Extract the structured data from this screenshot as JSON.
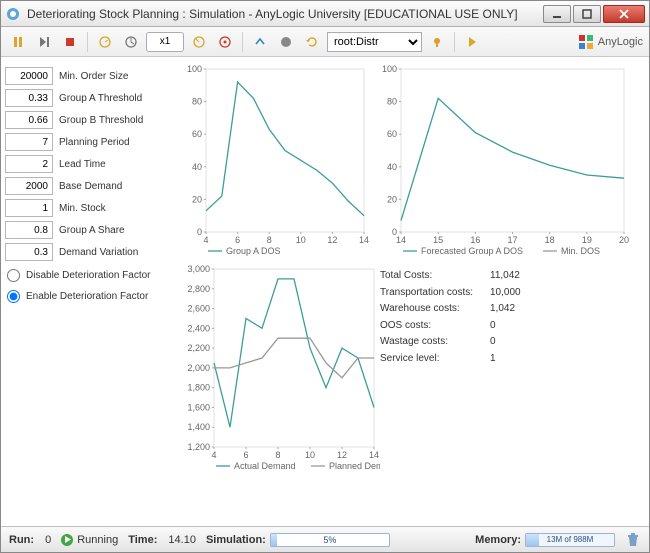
{
  "window": {
    "title": "Deteriorating Stock Planning : Simulation - AnyLogic University  [EDUCATIONAL USE ONLY]"
  },
  "toolbar": {
    "speed": "x1",
    "nav_value": "root:Distr",
    "brand": "AnyLogic"
  },
  "params": {
    "min_order_size": {
      "value": "20000",
      "label": "Min. Order Size"
    },
    "group_a_threshold": {
      "value": "0.33",
      "label": "Group A Threshold"
    },
    "group_b_threshold": {
      "value": "0.66",
      "label": "Group B Threshold"
    },
    "planning_period": {
      "value": "7",
      "label": "Planning Period"
    },
    "lead_time": {
      "value": "2",
      "label": "Lead Time"
    },
    "base_demand": {
      "value": "2000",
      "label": "Base Demand"
    },
    "min_stock": {
      "value": "1",
      "label": "Min. Stock"
    },
    "group_a_share": {
      "value": "0.8",
      "label": "Group A Share"
    },
    "demand_variation": {
      "value": "0.3",
      "label": "Demand Variation"
    }
  },
  "radios": {
    "disable": "Disable Deterioration Factor",
    "enable": "Enable Deterioration Factor",
    "selected": "enable"
  },
  "costs": {
    "total_label": "Total Costs:",
    "total_value": "11,042",
    "transport_label": "Transportation costs:",
    "transport_value": "10,000",
    "warehouse_label": "Warehouse costs:",
    "warehouse_value": "1,042",
    "oos_label": "OOS costs:",
    "oos_value": "0",
    "wastage_label": "Wastage costs:",
    "wastage_value": "0",
    "service_label": "Service level:",
    "service_value": "1"
  },
  "status": {
    "run_label": "Run:",
    "run_value": "0",
    "state": "Running",
    "time_label": "Time:",
    "time_value": "14.10",
    "sim_label": "Simulation:",
    "sim_progress_pct": 5,
    "sim_progress_text": "5%",
    "mem_label": "Memory:",
    "mem_text": "13M of 988M"
  },
  "chart_data": [
    {
      "id": "group_a_dos",
      "type": "line",
      "title": "",
      "xlabel": "",
      "ylabel": "",
      "xlim": [
        4,
        14
      ],
      "ylim": [
        0,
        100
      ],
      "x_ticks": [
        4,
        6,
        8,
        10,
        12,
        14
      ],
      "y_ticks": [
        0,
        20,
        40,
        60,
        80,
        100
      ],
      "series": [
        {
          "name": "Group A DOS",
          "color": "#3b9e95",
          "x": [
            4,
            5,
            6,
            7,
            8,
            9,
            10,
            11,
            12,
            13,
            14
          ],
          "y": [
            13,
            22,
            92,
            82,
            63,
            50,
            44,
            38,
            30,
            19,
            10
          ]
        }
      ],
      "legend": [
        "Group A DOS"
      ]
    },
    {
      "id": "forecasted_dos",
      "type": "line",
      "xlim": [
        14,
        20
      ],
      "ylim": [
        0,
        100
      ],
      "x_ticks": [
        14,
        15,
        16,
        17,
        18,
        19,
        20
      ],
      "y_ticks": [
        0,
        20,
        40,
        60,
        80,
        100
      ],
      "series": [
        {
          "name": "Forecasted Group A DOS",
          "color": "#3b9e95",
          "x": [
            14,
            15,
            16,
            17,
            18,
            19,
            20
          ],
          "y": [
            7,
            82,
            61,
            49,
            41,
            35,
            33
          ]
        },
        {
          "name": "Min. DOS",
          "color": "#999999",
          "x": [
            14,
            20
          ],
          "y": [
            null,
            null
          ]
        }
      ],
      "legend": [
        "Forecasted Group A DOS",
        "Min. DOS"
      ]
    },
    {
      "id": "demand",
      "type": "line",
      "xlim": [
        4,
        14
      ],
      "ylim": [
        1200,
        3000
      ],
      "x_ticks": [
        4,
        6,
        8,
        10,
        12,
        14
      ],
      "y_ticks": [
        1200,
        1400,
        1600,
        1800,
        2000,
        2200,
        2400,
        2600,
        2800,
        3000
      ],
      "series": [
        {
          "name": "Actual Demand",
          "color": "#3b9e95",
          "x": [
            4,
            5,
            6,
            7,
            8,
            9,
            10,
            11,
            12,
            13,
            14
          ],
          "y": [
            2050,
            1400,
            2500,
            2400,
            2900,
            2900,
            2200,
            1800,
            2200,
            2100,
            1600
          ]
        },
        {
          "name": "Planned Demand",
          "color": "#999999",
          "x": [
            4,
            5,
            6,
            7,
            8,
            9,
            10,
            11,
            12,
            13,
            14
          ],
          "y": [
            2000,
            2000,
            2050,
            2100,
            2300,
            2300,
            2300,
            2050,
            1900,
            2100,
            2100
          ]
        }
      ],
      "legend": [
        "Actual Demand",
        "Planned Demand"
      ]
    }
  ]
}
